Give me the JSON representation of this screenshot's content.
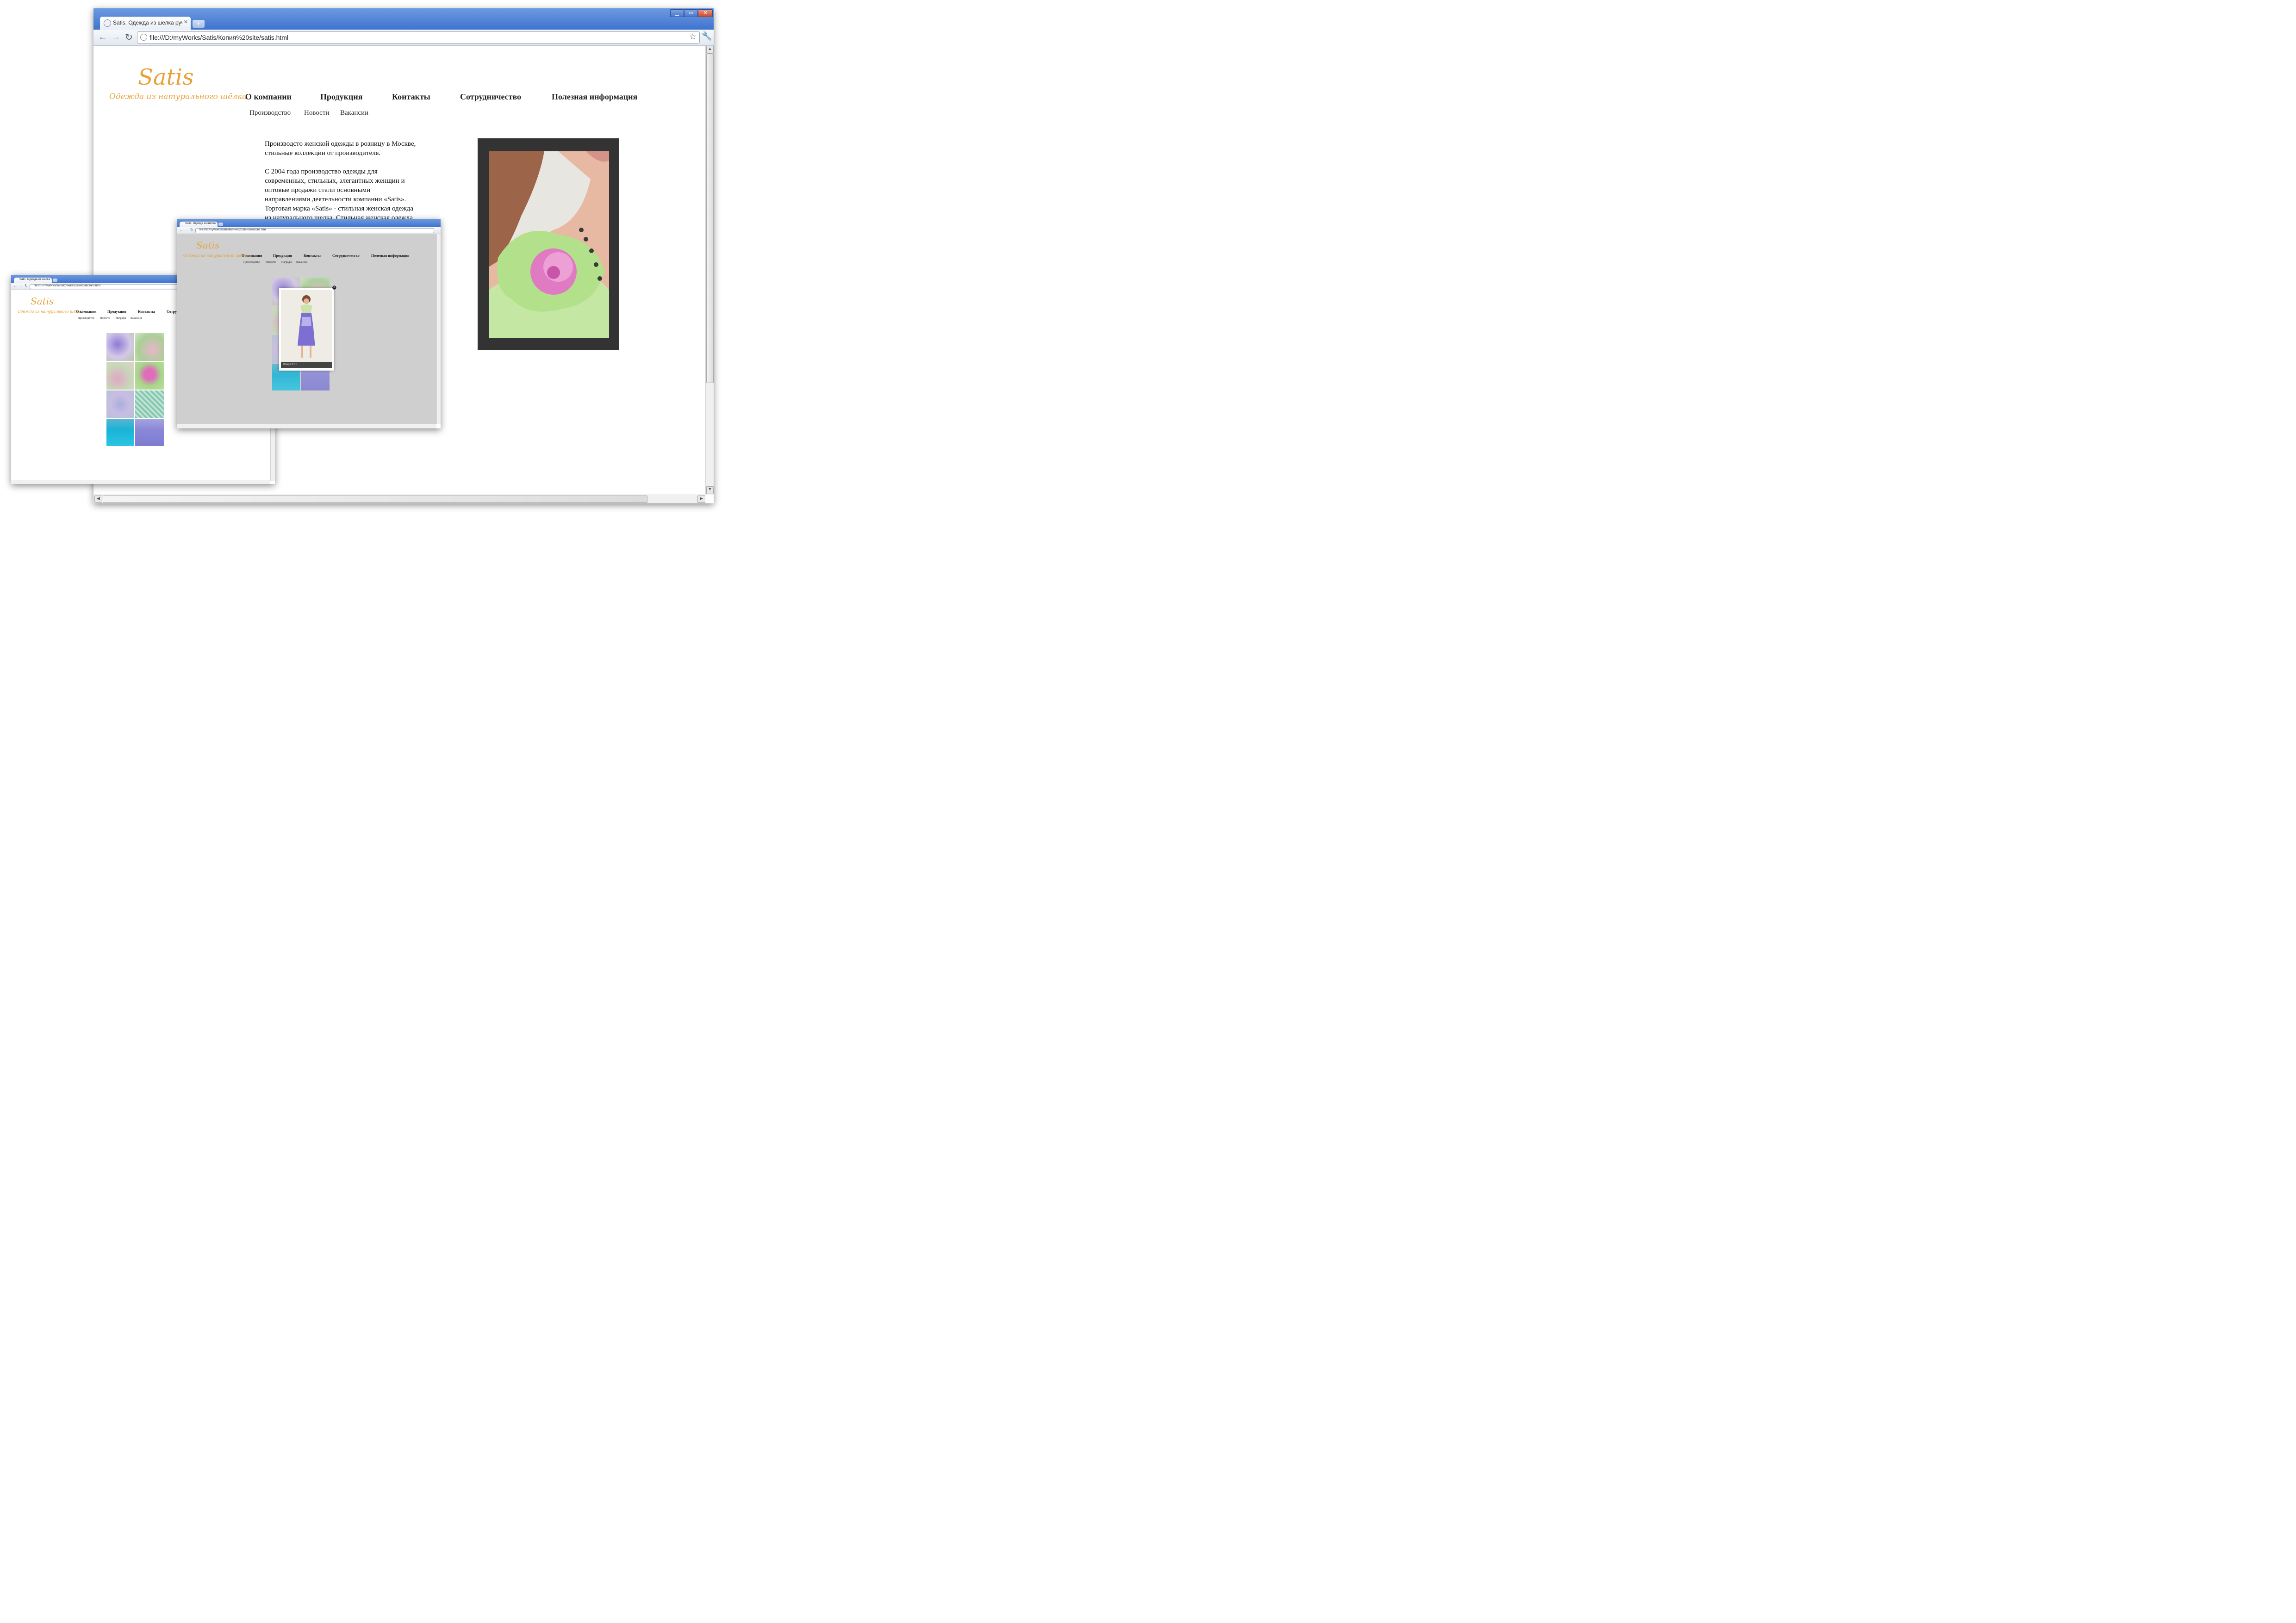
{
  "main_window": {
    "tab_title": "Satis. Одежда из шелка руч",
    "new_tab": "+",
    "controls": {
      "minimize": "▁",
      "maximize": "▭",
      "close": "✕"
    },
    "url": "file:///D:/myWorks/Satis/Копия%20site/satis.html",
    "page": {
      "logo_title": "Satis",
      "logo_tagline": "Одежда из натурального шёлка",
      "menu": [
        "О компании",
        "Продукция",
        "Контакты",
        "Сотрудничество",
        "Полезная информация"
      ],
      "submenu": [
        "Производство",
        "Новости",
        "Вакансии"
      ],
      "text_intro_1": "Производсто женской одежды в розницу в Москве,",
      "text_intro_2": "стильные коллекции от производителя.",
      "body_lines": [
        "С 2004 года производство одежды для",
        "современных, стильных, элегантных женщин и",
        "оптовые продажи стали основными",
        "направлениями деятельности компании «Satis».",
        "Торговая марка «Satis» - стильная женская одежда",
        "из натурального шелка. Стильная женская одежда"
      ]
    }
  },
  "middle_window": {
    "tab_title": "Satis. Одежда из шелка руч",
    "url": "file:///D:/myWorks/Satis/Копия%20site/collections.html",
    "page": {
      "logo_title": "Satis",
      "logo_tagline": "Одежда из натурального шёлка",
      "menu": [
        "О компании",
        "Продукция",
        "Контакты",
        "Сотрудничество",
        "Полезная информация"
      ],
      "submenu": [
        "Производство",
        "Новости",
        "Награды",
        "Вакансии"
      ],
      "lightbox_caption": "Image 8 / 8"
    }
  },
  "back_window": {
    "tab_title": "Satis. Одежда из шелка руч",
    "url": "file:///D:/myWorks/Satis/Копия%20site/collections.html",
    "page": {
      "logo_title": "Satis",
      "logo_tagline": "Одежда из натурального шёлка",
      "menu": [
        "О компании",
        "Продукция",
        "Контакты",
        "Сотру"
      ],
      "submenu": [
        "Производство",
        "Новости",
        "Награды",
        "Вакансии"
      ]
    }
  },
  "colors": {
    "logo": "#e8a23a",
    "title_bar": "#4f80d4",
    "photo_frame": "#333333",
    "overlay": "#cfcfcf"
  }
}
